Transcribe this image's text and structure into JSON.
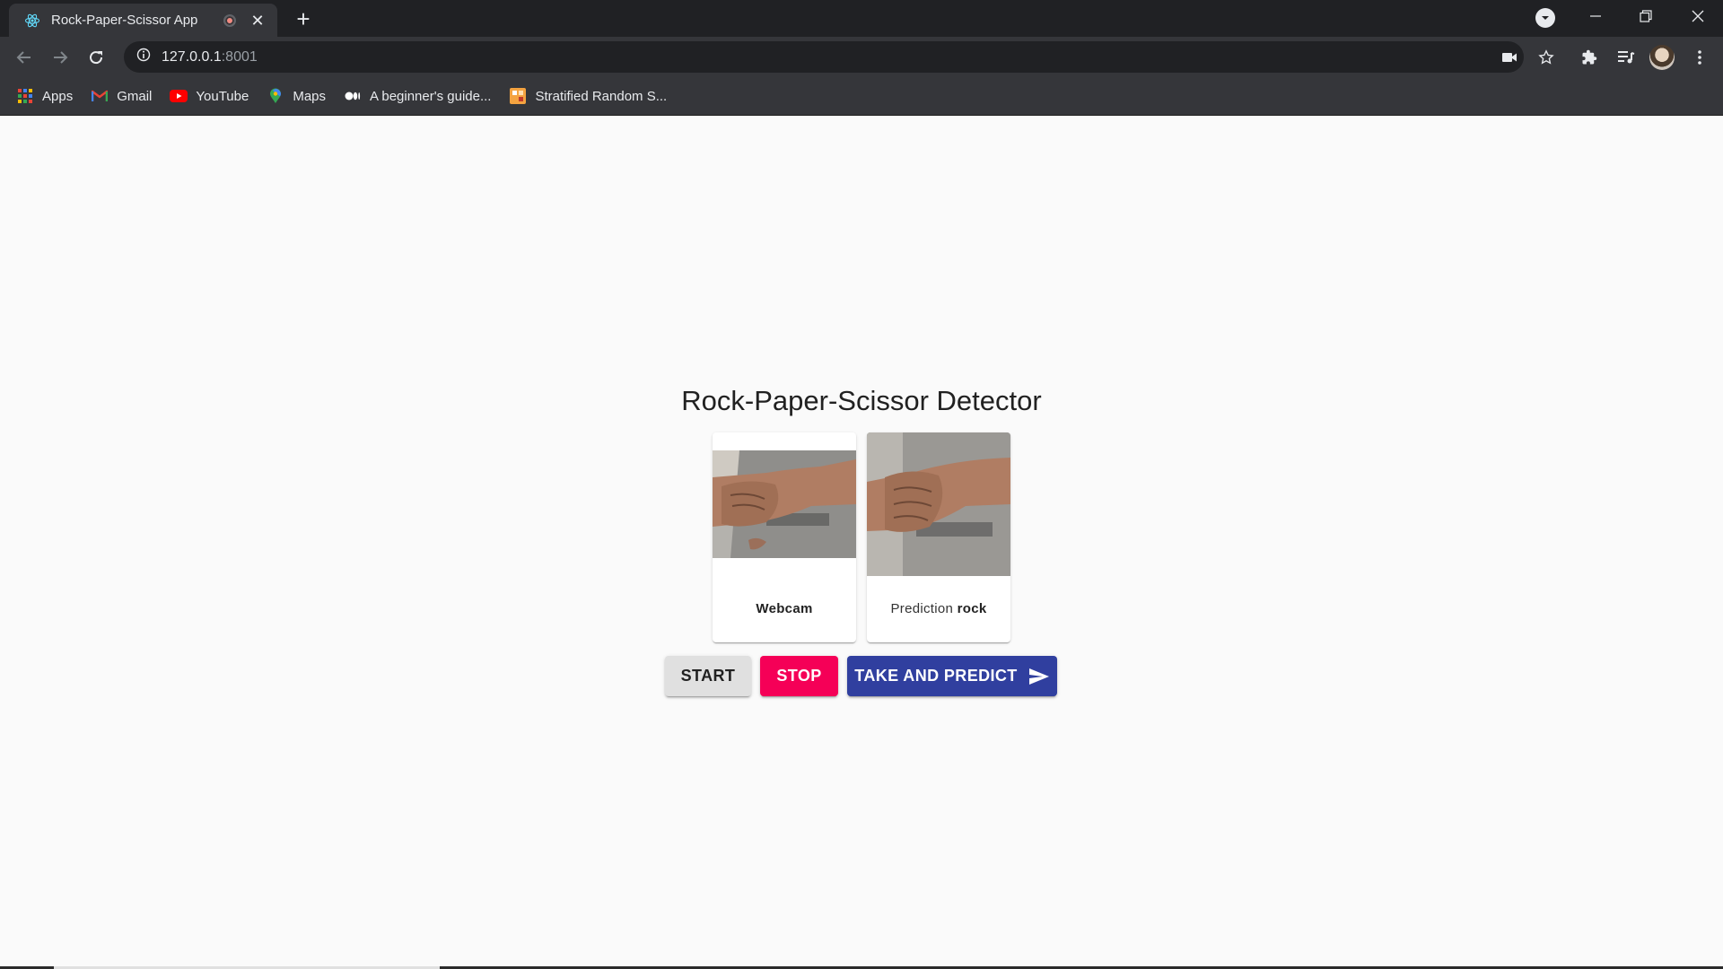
{
  "browser": {
    "tab": {
      "title": "Rock-Paper-Scissor App",
      "favicon": "react-icon",
      "recording": true
    },
    "address": {
      "host": "127.0.0.1",
      "port": ":8001"
    },
    "bookmarks": [
      {
        "label": "Apps",
        "icon": "apps-grid-icon"
      },
      {
        "label": "Gmail",
        "icon": "gmail-icon"
      },
      {
        "label": "YouTube",
        "icon": "youtube-icon"
      },
      {
        "label": "Maps",
        "icon": "maps-pin-icon"
      },
      {
        "label": "A beginner's guide...",
        "icon": "medium-icon"
      },
      {
        "label": "Stratified Random S...",
        "icon": "bookmark-site-icon"
      }
    ]
  },
  "app": {
    "title": "Rock-Paper-Scissor Detector",
    "webcam_card": {
      "label": "Webcam"
    },
    "prediction_card": {
      "prefix": "Prediction",
      "value": "rock"
    },
    "buttons": {
      "start": "START",
      "stop": "STOP",
      "predict": "TAKE AND PREDICT"
    }
  },
  "colors": {
    "stop": "#f50057",
    "predict": "#303f9f",
    "start": "#e0e0e0"
  }
}
